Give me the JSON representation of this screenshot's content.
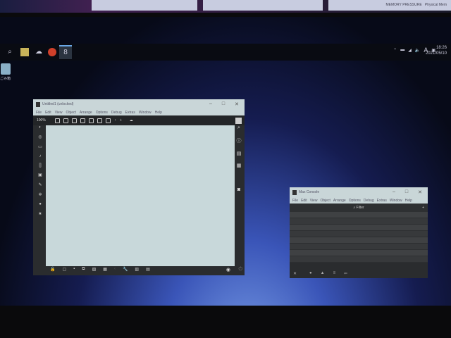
{
  "background_monitor": {
    "memory_pressure": "MEMORY PRESSURE",
    "physical_mem": "Physical Mem"
  },
  "taskbar": {
    "icons": [
      "search-icon",
      "file-explorer-icon",
      "network-icon",
      "firefox-icon",
      "max-icon"
    ],
    "time": "18:26",
    "date": "2021/05/10",
    "ime": "A"
  },
  "desktop": {
    "recycle_bin": "ごみ箱"
  },
  "patcher": {
    "title": "Untitled1 (unlocked)",
    "menus": [
      "File",
      "Edit",
      "View",
      "Object",
      "Arrange",
      "Options",
      "Debug",
      "Extras",
      "Window",
      "Help"
    ],
    "zoom": "100%"
  },
  "console": {
    "title": "Max Console",
    "menus": [
      "File",
      "Edit",
      "View",
      "Object",
      "Arrange",
      "Options",
      "Debug",
      "Extras",
      "Window",
      "Help"
    ],
    "filter": "Filter"
  }
}
